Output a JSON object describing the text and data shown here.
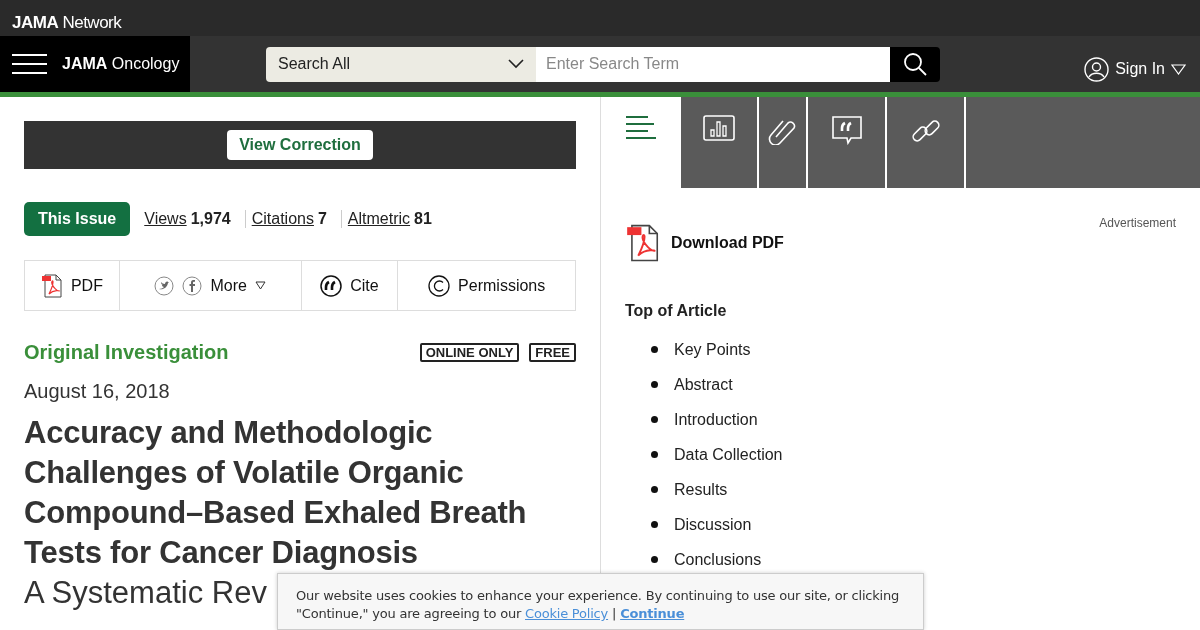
{
  "network": {
    "brand": "JAMA",
    "suffix": "Network"
  },
  "journal": {
    "brand": "JAMA",
    "name": "Oncology"
  },
  "search": {
    "scope": "Search All",
    "placeholder": "Enter Search Term"
  },
  "account": {
    "label": "Sign In"
  },
  "correction": {
    "label": "View Correction"
  },
  "issue_button": {
    "label": "This Issue"
  },
  "metrics": [
    {
      "label": "Views",
      "value": "1,974"
    },
    {
      "label": "Citations",
      "value": "7"
    },
    {
      "label": "Altmetric",
      "value": "81"
    }
  ],
  "actions": [
    {
      "kind": "pdf",
      "label": "PDF"
    },
    {
      "kind": "share",
      "label": "More"
    },
    {
      "kind": "cite",
      "label": "Cite"
    },
    {
      "kind": "permissions",
      "label": "Permissions"
    }
  ],
  "article": {
    "type": "Original Investigation",
    "badges": [
      "ONLINE ONLY",
      "FREE"
    ],
    "date": "August 16, 2018",
    "title": "Accuracy and Methodologic Challenges of Volatile Organic Compound–Based Exhaled Breath Tests for Cancer Diagnosis",
    "subtitle": "A Systematic Rev"
  },
  "side_tabs": [
    {
      "kind": "outline",
      "selected": true
    },
    {
      "kind": "figures",
      "selected": false
    },
    {
      "kind": "supplement",
      "selected": false
    },
    {
      "kind": "comments",
      "selected": false
    },
    {
      "kind": "related",
      "selected": false
    }
  ],
  "advertisement": "Advertisement",
  "download": {
    "label": "Download PDF"
  },
  "toc": {
    "heading": "Top of Article",
    "items": [
      "Key Points",
      "Abstract",
      "Introduction",
      "Data Collection",
      "Results",
      "Discussion",
      "Conclusions"
    ]
  },
  "cookie": {
    "text": "Our website uses cookies to enhance your experience. By continuing to use our site, or clicking \"Continue,\" you are agreeing to our ",
    "policy_link": "Cookie Policy",
    "separator": "|",
    "continue_link": "Continue"
  }
}
